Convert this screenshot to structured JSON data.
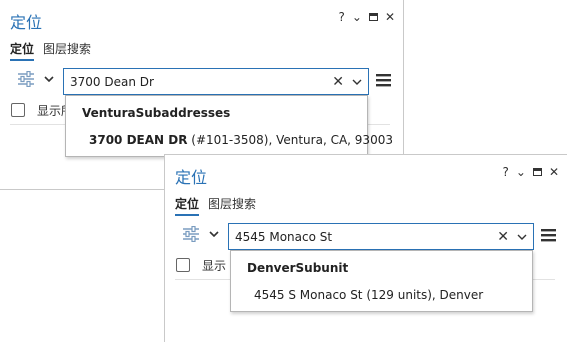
{
  "pane1": {
    "title": "定位",
    "controls": {
      "help": "?",
      "options": "⌄",
      "close": "✕"
    },
    "tabs": [
      {
        "label": "定位"
      },
      {
        "label": "图层搜索"
      }
    ],
    "search": {
      "value": "3700 Dean Dr"
    },
    "checkbox_label": "显示所",
    "results": {
      "header": "VenturaSubaddresses",
      "item_bold": "3700 DEAN DR",
      "item_rest": " (#101-3508), Ventura, CA, 93003"
    }
  },
  "pane2": {
    "title": "定位",
    "controls": {
      "help": "?",
      "options": "⌄",
      "close": "✕"
    },
    "tabs": [
      {
        "label": "定位"
      },
      {
        "label": "图层搜索"
      }
    ],
    "search": {
      "value": "4545 Monaco St"
    },
    "checkbox_label": "显示",
    "results": {
      "header": "DenverSubunit",
      "item_bold": "",
      "item_rest": "4545 S Monaco St (129 units), Denver"
    }
  },
  "icons": {
    "help": "question-mark-icon",
    "options": "chevron-down-icon",
    "maximize": "maximize-icon",
    "close": "close-icon",
    "filter": "sliders-icon",
    "clear": "clear-x-icon",
    "menu": "hamburger-menu-icon"
  },
  "colors": {
    "accent": "#2a72b5",
    "border": "#c9c9c9"
  }
}
